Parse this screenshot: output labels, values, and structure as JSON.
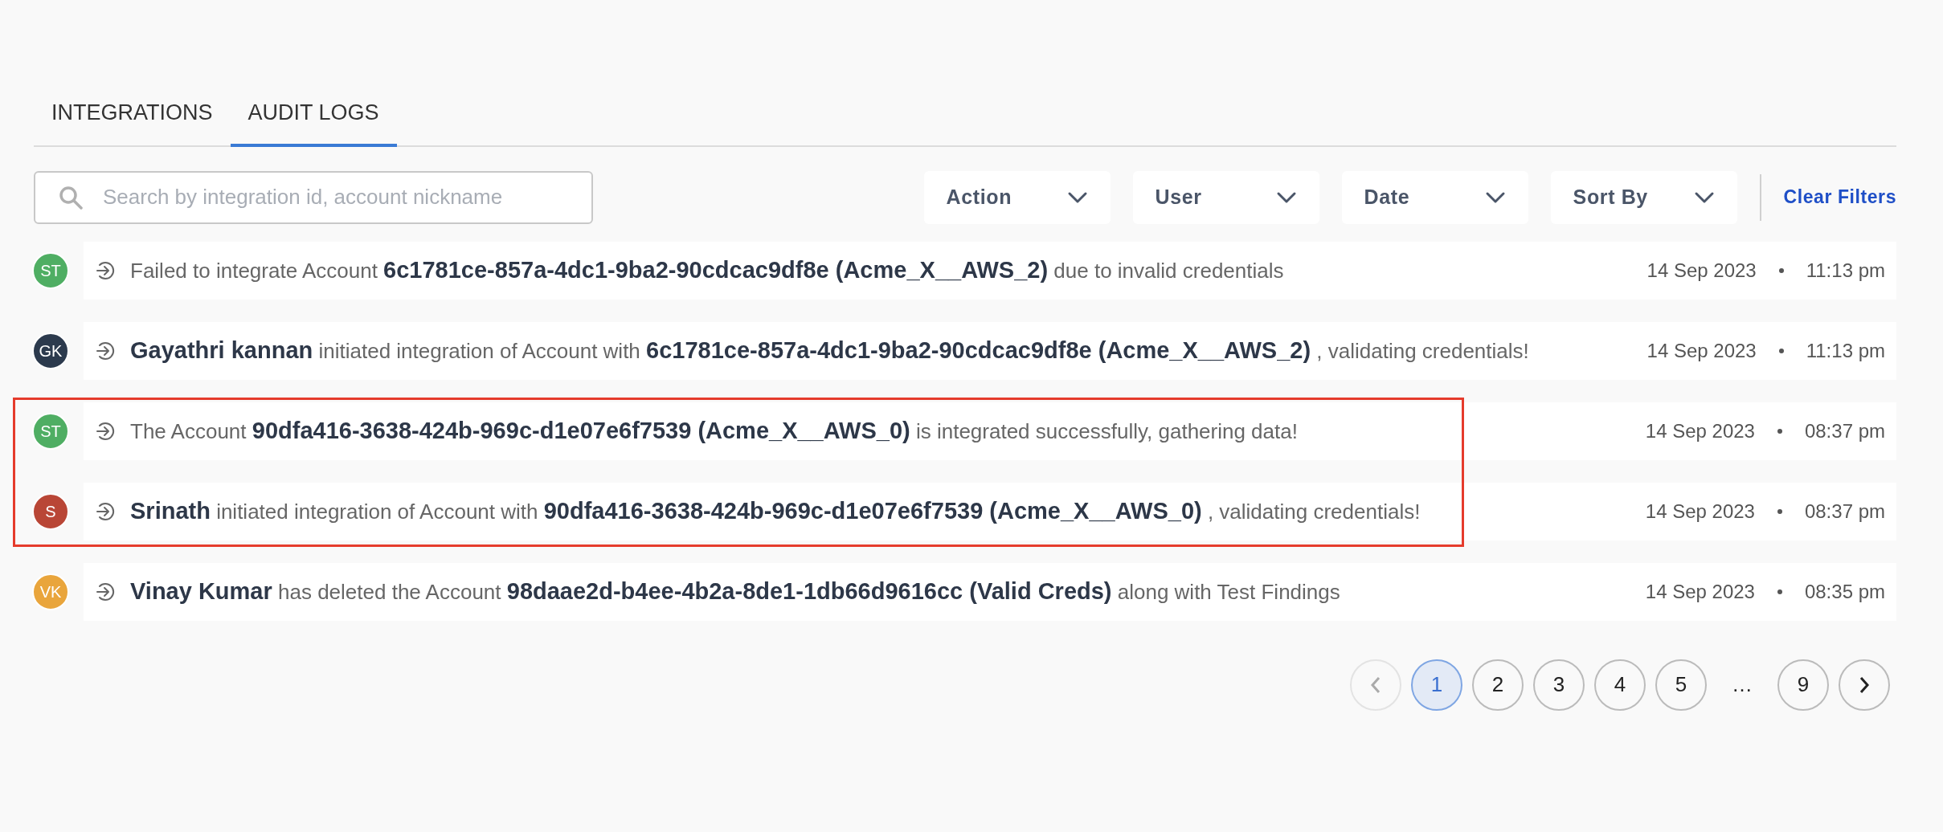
{
  "tabs": [
    {
      "label": "INTEGRATIONS",
      "selected": false
    },
    {
      "label": "AUDIT LOGS",
      "selected": true
    }
  ],
  "search": {
    "placeholder": "Search by integration id, account nickname"
  },
  "filters": [
    {
      "label": "Action"
    },
    {
      "label": "User"
    },
    {
      "label": "Date"
    },
    {
      "label": "Sort By"
    }
  ],
  "clear_filters": "Clear Filters",
  "logs": [
    {
      "initials": "ST",
      "color": "#4fae63",
      "message": "Failed to integrate Account **6c1781ce-857a-4dc1-9ba2-90cdcac9df8e (Acme_X__AWS_2)** due to invalid credentials",
      "date": "14 Sep 2023",
      "time": "11:13 pm",
      "highlighted": false
    },
    {
      "initials": "GK",
      "color": "#2c3a4d",
      "message": "**Gayathri kannan** initiated integration of Account with **6c1781ce-857a-4dc1-9ba2-90cdcac9df8e (Acme_X__AWS_2)** , validating credentials!",
      "date": "14 Sep 2023",
      "time": "11:13 pm",
      "highlighted": false
    },
    {
      "initials": "ST",
      "color": "#4fae63",
      "message": "The Account **90dfa416-3638-424b-969c-d1e07e6f7539 (Acme_X__AWS_0)** is integrated successfully, gathering data!",
      "date": "14 Sep 2023",
      "time": "08:37 pm",
      "highlighted": true
    },
    {
      "initials": "S",
      "color": "#b94636",
      "message": "**Srinath** initiated integration of Account with **90dfa416-3638-424b-969c-d1e07e6f7539 (Acme_X__AWS_0)** , validating credentials!",
      "date": "14 Sep 2023",
      "time": "08:37 pm",
      "highlighted": true
    },
    {
      "initials": "VK",
      "color": "#e9a53c",
      "message": "**Vinay Kumar** has deleted the Account **98daae2d-b4ee-4b2a-8de1-1db66d9616cc (Valid Creds)** along with Test Findings",
      "date": "14 Sep 2023",
      "time": "08:35 pm",
      "highlighted": false
    }
  ],
  "pagination": {
    "prev_disabled": true,
    "next_disabled": false,
    "pages": [
      {
        "label": "1",
        "kind": "page",
        "selected": true
      },
      {
        "label": "2",
        "kind": "page",
        "selected": false
      },
      {
        "label": "3",
        "kind": "page",
        "selected": false
      },
      {
        "label": "4",
        "kind": "page",
        "selected": false
      },
      {
        "label": "5",
        "kind": "page",
        "selected": false
      },
      {
        "label": "…",
        "kind": "ellipsis"
      },
      {
        "label": "9",
        "kind": "page",
        "selected": false
      }
    ]
  }
}
